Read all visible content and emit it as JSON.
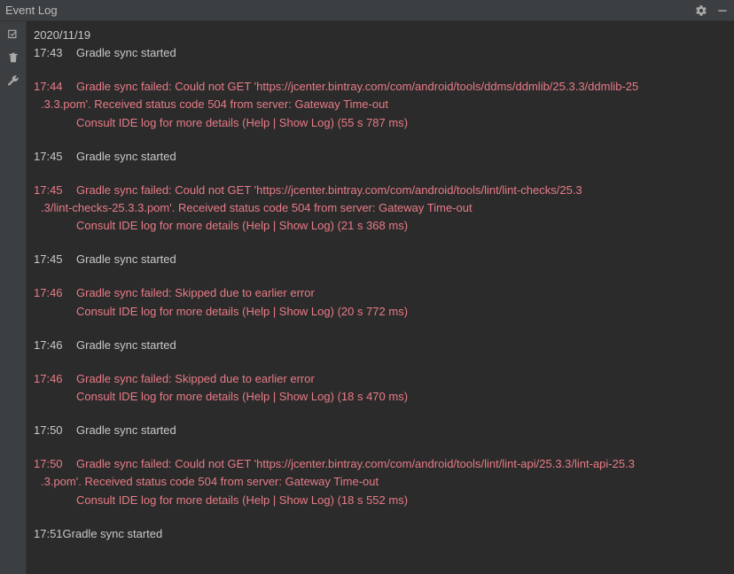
{
  "titlebar": {
    "title": "Event Log"
  },
  "date": "2020/11/19",
  "entries": [
    {
      "time": "17:43",
      "type": "normal",
      "lines": [
        "Gradle sync started"
      ]
    },
    {
      "time": "17:44",
      "type": "error",
      "lines": [
        "Gradle sync failed: Could not GET 'https://jcenter.bintray.com/com/android/tools/ddms/ddmlib/25.3.3/ddmlib-25",
        ".3.3.pom'. Received status code 504 from server: Gateway Time-out"
      ],
      "linkLine": "Consult IDE log for more details (Help | Show Log) (55 s 787 ms)"
    },
    {
      "time": "17:45",
      "type": "normal",
      "lines": [
        "Gradle sync started"
      ]
    },
    {
      "time": "17:45",
      "type": "error",
      "lines": [
        "Gradle sync failed: Could not GET 'https://jcenter.bintray.com/com/android/tools/lint/lint-checks/25.3",
        ".3/lint-checks-25.3.3.pom'. Received status code 504 from server: Gateway Time-out"
      ],
      "linkLine": "Consult IDE log for more details (Help | Show Log) (21 s 368 ms)"
    },
    {
      "time": "17:45",
      "type": "normal",
      "lines": [
        "Gradle sync started"
      ]
    },
    {
      "time": "17:46",
      "type": "error",
      "lines": [
        "Gradle sync failed: Skipped due to earlier error"
      ],
      "linkLine": "Consult IDE log for more details (Help | Show Log) (20 s 772 ms)"
    },
    {
      "time": "17:46",
      "type": "normal",
      "lines": [
        "Gradle sync started"
      ]
    },
    {
      "time": "17:46",
      "type": "error",
      "lines": [
        "Gradle sync failed: Skipped due to earlier error"
      ],
      "linkLine": "Consult IDE log for more details (Help | Show Log) (18 s 470 ms)"
    },
    {
      "time": "17:50",
      "type": "normal",
      "lines": [
        "Gradle sync started"
      ]
    },
    {
      "time": "17:50",
      "type": "error",
      "lines": [
        "Gradle sync failed: Could not GET 'https://jcenter.bintray.com/com/android/tools/lint/lint-api/25.3.3/lint-api-25.3",
        ".3.pom'. Received status code 504 from server: Gateway Time-out"
      ],
      "linkLine": "Consult IDE log for more details (Help | Show Log) (18 s 552 ms)"
    },
    {
      "time": "17:51",
      "type": "normal",
      "lines": [
        "Gradle sync started"
      ],
      "compact": true
    }
  ]
}
